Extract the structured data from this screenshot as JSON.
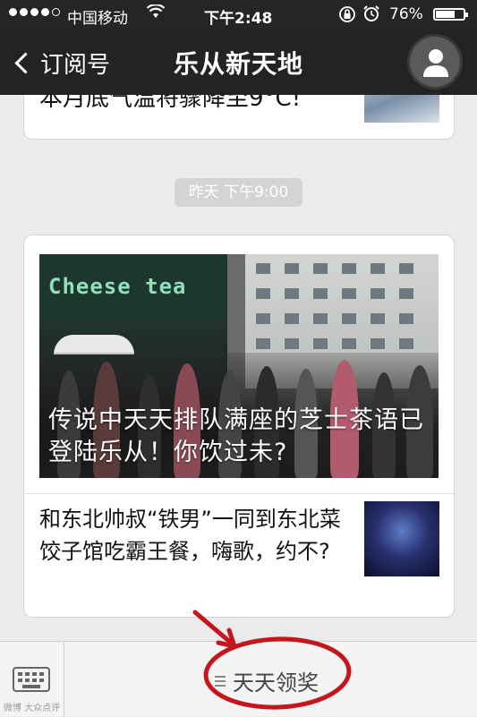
{
  "status_bar": {
    "carrier": "中国移动",
    "time": "下午2:48",
    "battery_percent_label": "76%",
    "battery_level": 0.76,
    "signal_bars": 4,
    "icons": [
      "signal-dots-icon",
      "wifi-icon",
      "rotation-lock-icon",
      "alarm-icon",
      "battery-icon"
    ]
  },
  "nav": {
    "back_label": "订阅号",
    "title": "乐从新天地",
    "profile_icon": "person-icon"
  },
  "feed": {
    "previous_article_title": "本月底气温将骤降至9°C!",
    "timestamp": "昨天 下午9:00",
    "cover": {
      "sign_text": "Cheese tea",
      "caption": "传说中天天排队满座的芝士茶语已登陆乐从！你饮过未?"
    },
    "items": [
      {
        "title": "和东北帅叔“铁男”一同到东北菜饺子馆吃霸王餐，嗨歌，约不?"
      }
    ]
  },
  "bottom_bar": {
    "keyboard_icon": "keyboard-icon",
    "menu_icon": "menu-lines-icon",
    "menu_label": "天天领奖"
  },
  "watermark": "微博 大众点评",
  "colors": {
    "navbar": "#232323",
    "background": "#ebebeb",
    "annotation": "#c4161c"
  }
}
